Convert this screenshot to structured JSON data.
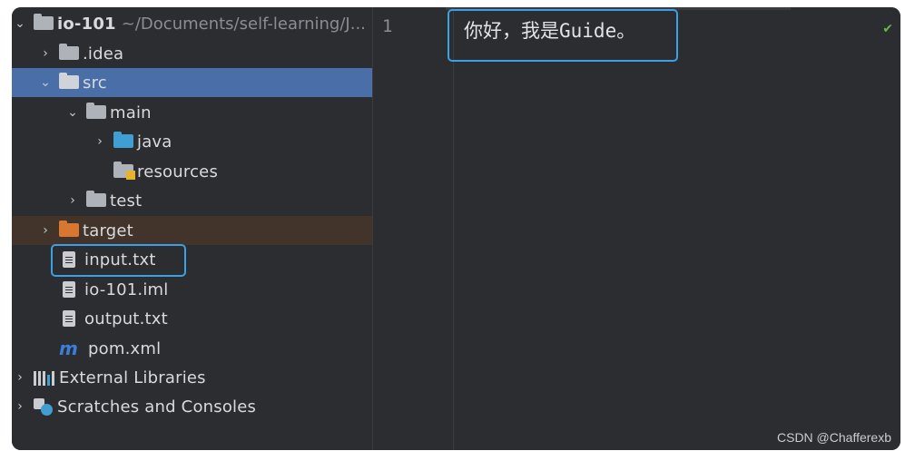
{
  "project": {
    "root": {
      "label": "io-101",
      "path": "~/Documents/self-learning/J..."
    },
    "items": [
      {
        "label": ".idea",
        "icon": "folder-icon"
      },
      {
        "label": "src",
        "icon": "folder-icon"
      },
      {
        "label": "main",
        "icon": "folder-icon"
      },
      {
        "label": "java",
        "icon": "source-folder-icon"
      },
      {
        "label": "resources",
        "icon": "resources-folder-icon"
      },
      {
        "label": "test",
        "icon": "folder-icon"
      },
      {
        "label": "target",
        "icon": "excluded-folder-icon"
      },
      {
        "label": "input.txt",
        "icon": "text-file-icon"
      },
      {
        "label": "io-101.iml",
        "icon": "module-file-icon"
      },
      {
        "label": "output.txt",
        "icon": "text-file-icon"
      },
      {
        "label": "pom.xml",
        "icon": "maven-icon"
      },
      {
        "label": "External Libraries",
        "icon": "libraries-icon"
      },
      {
        "label": "Scratches and Consoles",
        "icon": "scratches-icon"
      }
    ]
  },
  "editor": {
    "line_number": "1",
    "content": "你好，我是Guide。"
  },
  "watermark": "CSDN @Chafferexb",
  "colors": {
    "background": "#2b2d30",
    "selection": "#4a6fa8",
    "excluded": "#43342b",
    "highlight": "#3aa0e8"
  }
}
